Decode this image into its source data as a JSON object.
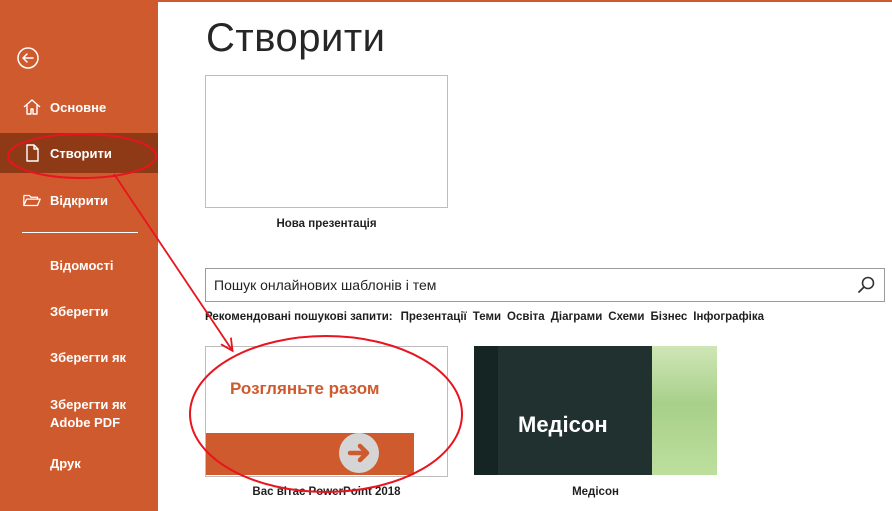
{
  "sidebar": {
    "items": [
      {
        "label": "Основне",
        "icon": "home-icon"
      },
      {
        "label": "Створити",
        "icon": "new-document-icon"
      },
      {
        "label": "Відкрити",
        "icon": "open-folder-icon"
      },
      {
        "label": "Відомості"
      },
      {
        "label": "Зберегти"
      },
      {
        "label": "Зберегти як"
      },
      {
        "label": "Зберегти як Adobe PDF"
      },
      {
        "label": "Друк"
      }
    ],
    "back_icon": "back-arrow-icon",
    "color": "#cf5a2e",
    "active_color": "#8e3a16"
  },
  "main": {
    "title": "Створити",
    "blank_template_label": "Нова презентація",
    "search": {
      "placeholder": "Пошук онлайнових шаблонів і тем",
      "value": "Пошук онлайнових шаблонів і тем"
    },
    "suggested": {
      "label": "Рекомендовані пошукові запити:",
      "items": [
        "Презентації",
        "Теми",
        "Освіта",
        "Діаграми",
        "Схеми",
        "Бізнес",
        "Інфографіка"
      ]
    },
    "templates": [
      {
        "thumb_title": "Розгляньте разом",
        "label": "Вас вітає PowerPoint 2018",
        "accent": "#cf5a2e"
      },
      {
        "thumb_title": "Медісон",
        "label": "Медісон"
      }
    ]
  },
  "annotation_color": "#e8141e"
}
